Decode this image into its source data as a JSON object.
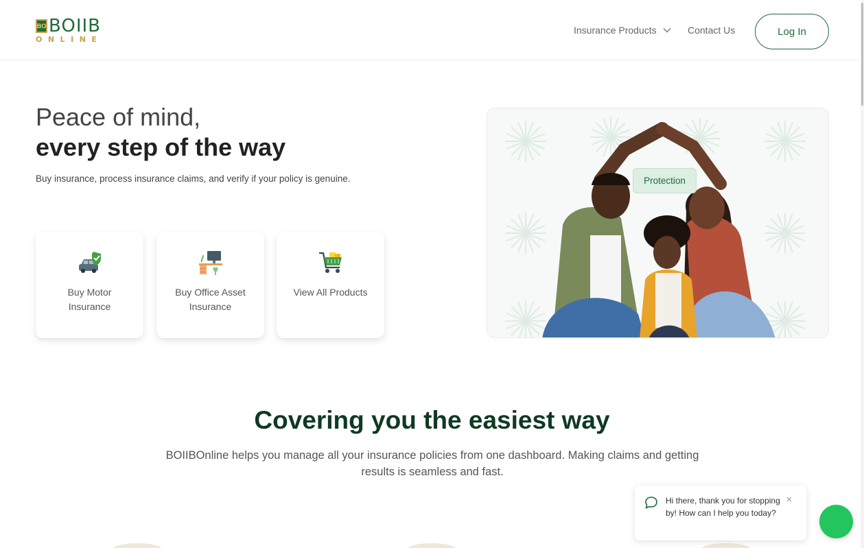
{
  "header": {
    "logo": {
      "badge_text": "BO",
      "word": "BOIIB",
      "sub": "ONLINE"
    },
    "nav": {
      "insurance_products": "Insurance Products",
      "contact_us": "Contact Us"
    },
    "login_label": "Log In"
  },
  "hero": {
    "line1": "Peace of mind,",
    "line2": "every step of the way",
    "subtitle": "Buy insurance, process insurance claims, and verify if your policy is genuine.",
    "cards": [
      {
        "label": "Buy Motor Insurance",
        "icon": "car-shield-icon"
      },
      {
        "label": "Buy Office Asset Insurance",
        "icon": "office-desk-icon"
      },
      {
        "label": "View All Products",
        "icon": "shopping-cart-icon"
      }
    ],
    "image_badge": "Protection"
  },
  "section": {
    "title": "Covering you the easiest way",
    "body": "BOIIBOnline helps you manage all your insurance policies from one dashboard. Making claims and getting results is seamless and fast."
  },
  "chat": {
    "message": "Hi there, thank you for stopping by! How can I help you today?",
    "close_glyph": "×"
  },
  "colors": {
    "brand_green": "#1f6b3a",
    "brand_gold": "#c9a14a",
    "dark_green_heading": "#0f3a22",
    "chat_fab": "#22c55e"
  }
}
